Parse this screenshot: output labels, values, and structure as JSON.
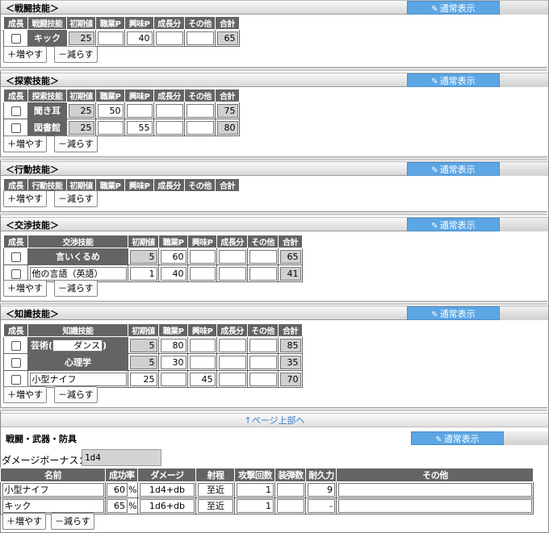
{
  "mode_button": "通常表示",
  "add_button": "＋増やす",
  "remove_button": "－減らす",
  "columns": {
    "grow": "成長",
    "initial": "初期値",
    "job": "職業P",
    "interest": "興味P",
    "growth": "成長分",
    "other": "その他",
    "total": "合計"
  },
  "combat": {
    "title": "＜戦闘技能＞",
    "skill_col": "戦闘技能",
    "rows": [
      {
        "name": "キック",
        "initial": "25",
        "job": "",
        "interest": "40",
        "growth": "",
        "other": "",
        "total": "65"
      }
    ]
  },
  "explore": {
    "title": "＜探索技能＞",
    "skill_col": "探索技能",
    "rows": [
      {
        "name": "聞き耳",
        "initial": "25",
        "job": "50",
        "interest": "",
        "growth": "",
        "other": "",
        "total": "75"
      },
      {
        "name": "図書館",
        "initial": "25",
        "job": "",
        "interest": "55",
        "growth": "",
        "other": "",
        "total": "80"
      }
    ]
  },
  "action": {
    "title": "＜行動技能＞",
    "skill_col": "行動技能"
  },
  "negotiation": {
    "title": "＜交渉技能＞",
    "skill_col": "交渉技能",
    "rows": [
      {
        "name": "言いくるめ",
        "initial": "5",
        "job": "60",
        "interest": "",
        "growth": "",
        "other": "",
        "total": "65"
      },
      {
        "name": "他の言語（英語）",
        "initial": "1",
        "job": "40",
        "interest": "",
        "growth": "",
        "other": "",
        "total": "41"
      }
    ]
  },
  "knowledge": {
    "title": "＜知識技能＞",
    "skill_col": "知識技能",
    "rows": [
      {
        "name_prefix": "芸術(",
        "name_detail": "ダンス",
        "name_suffix": ")",
        "initial": "5",
        "job": "80",
        "interest": "",
        "growth": "",
        "other": "",
        "total": "85"
      },
      {
        "name": "心理学",
        "initial": "5",
        "job": "30",
        "interest": "",
        "growth": "",
        "other": "",
        "total": "35"
      },
      {
        "name": "小型ナイフ",
        "initial": "25",
        "job": "",
        "interest": "45",
        "growth": "",
        "other": "",
        "total": "70"
      }
    ]
  },
  "page_top_link": "↑ページ上部へ",
  "weapons": {
    "title": "戦闘・武器・防具",
    "damage_bonus_label": "ダメージボーナス：",
    "damage_bonus_value": "1d4",
    "columns": {
      "name": "名前",
      "success": "成功率",
      "damage": "ダメージ",
      "range": "射程",
      "attacks": "攻撃回数",
      "ammo": "装弾数",
      "durability": "耐久力",
      "other": "その他"
    },
    "percent": "%",
    "rows": [
      {
        "name": "小型ナイフ",
        "success": "60",
        "damage": "1d4+db",
        "range": "至近",
        "attacks": "1",
        "ammo": "",
        "durability": "9",
        "other": ""
      },
      {
        "name": "キック",
        "success": "65",
        "damage": "1d6+db",
        "range": "至近",
        "attacks": "1",
        "ammo": "",
        "durability": "-",
        "other": ""
      }
    ]
  },
  "colors": {
    "header_dark": "#646464",
    "accent": "#5da6e4",
    "link": "#3d7fd0"
  }
}
